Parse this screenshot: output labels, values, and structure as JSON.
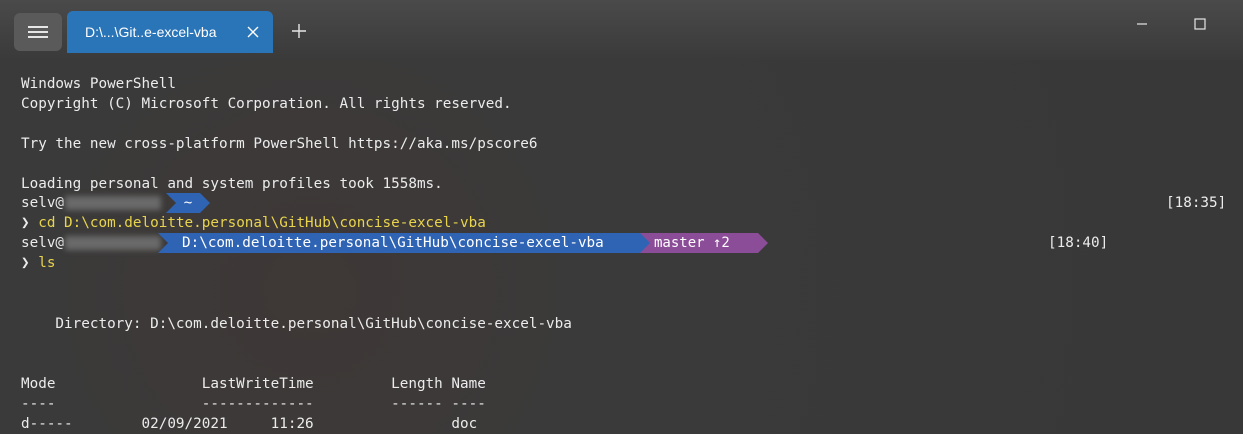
{
  "window": {
    "tab_title": "D:\\...\\Git..e-excel-vba",
    "icons": [
      "menu-icon",
      "close-icon",
      "plus-icon",
      "minimize-icon",
      "maximize-icon"
    ]
  },
  "terminal": {
    "banner_line1": "Windows PowerShell",
    "banner_line2": "Copyright (C) Microsoft Corporation. All rights reserved.",
    "banner_line3": "Try the new cross-platform PowerShell https://aka.ms/pscore6",
    "profile_line": "Loading personal and system profiles took 1558ms.",
    "user_prefix": "selv@",
    "prompt1_path": "~",
    "prompt1_time": "[18:35]",
    "prompt_symbol": "❯",
    "cmd1": "cd D:\\com.deloitte.personal\\GitHub\\concise-excel-vba",
    "prompt2_path": "D:\\com.deloitte.personal\\GitHub\\concise-excel-vba",
    "prompt2_git": "master ↑2",
    "prompt2_time": "[18:40]",
    "cmd2": "ls",
    "directory_line": "    Directory: D:\\com.deloitte.personal\\GitHub\\concise-excel-vba",
    "table": {
      "headers": "Mode                 LastWriteTime         Length Name",
      "separator": "----                 -------------         ------ ----",
      "rows": [
        "d-----        02/09/2021     11:26                doc"
      ]
    },
    "colors": {
      "background": "#383838",
      "path_segment": "#2f63b3",
      "git_segment": "#8c4d98",
      "command": "#e8d44d",
      "tab_active": "#2a74b8"
    }
  }
}
